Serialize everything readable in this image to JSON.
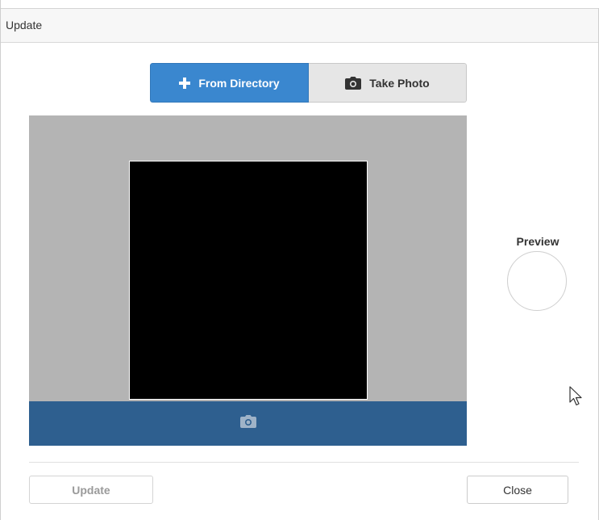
{
  "dialog": {
    "title": "Update"
  },
  "source_toggle": {
    "from_directory": {
      "label": "From Directory",
      "icon": "plus-icon",
      "active": true
    },
    "take_photo": {
      "label": "Take Photo",
      "icon": "camera-icon",
      "active": false
    }
  },
  "camera": {
    "capture_icon": "camera-icon"
  },
  "preview": {
    "label": "Preview"
  },
  "footer": {
    "update_label": "Update",
    "close_label": "Close"
  },
  "colors": {
    "accent": "#3a87cf",
    "capture_bar": "#2e5f8f",
    "camera_background": "#b4b4b4",
    "video": "#000000"
  }
}
